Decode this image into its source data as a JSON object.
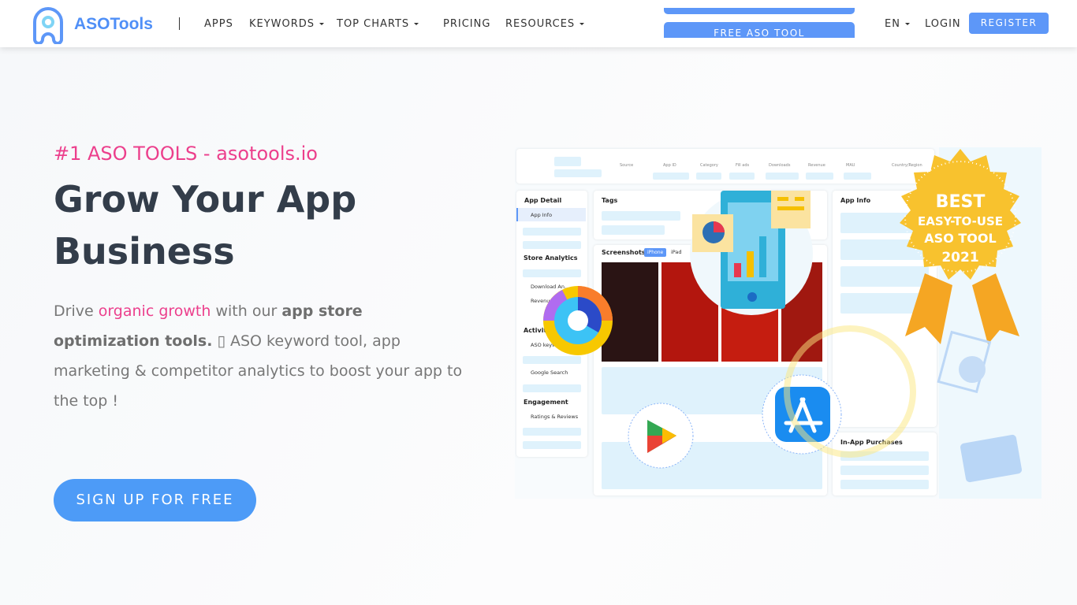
{
  "nav": {
    "logo_text": "ASOTools",
    "items": [
      {
        "label": "APPS",
        "dropdown": false
      },
      {
        "label": "KEYWORDS",
        "dropdown": true
      },
      {
        "label": "TOP CHARTS",
        "dropdown": true
      },
      {
        "label": "PRICING",
        "dropdown": false
      },
      {
        "label": "RESOURCES",
        "dropdown": true
      }
    ],
    "free_tool": "FREE ASO TOOL",
    "language": "EN",
    "login": "LOGIN",
    "register": "REGISTER"
  },
  "hero": {
    "tagline": "#1 ASO TOOLS - asotools.io",
    "title": "Grow Your App Business",
    "desc": {
      "p1": "Drive ",
      "link": "organic growth",
      "p2": " with our ",
      "bold": "app store optimization tools.",
      "p3": " ▯ ASO keyword tool, app marketing & competitor analytics to boost your app to the top !"
    },
    "cta": "SIGN UP FOR FREE"
  },
  "mockup": {
    "columns": [
      "Source",
      "App ID",
      "Category",
      "Fill ads",
      "Downloads",
      "Revenue",
      "MAU",
      "Country/Region"
    ],
    "sidebar": {
      "app_detail": "App Detail",
      "app_info": "App Info",
      "store_analytics": "Store Analytics",
      "download": "Download An...",
      "revenue": "Revenue",
      "activity": "Activity",
      "aso_keywords": "ASO keywords",
      "google_search": "Google Search",
      "engagement": "Engagement",
      "ratings": "Ratings & Reviews"
    },
    "tags": "Tags",
    "screenshots": "Screenshots",
    "iphone": "iPhone",
    "ipad": "iPad",
    "app_info": "App Info",
    "in_app": "In-App Purchases",
    "badge": [
      "BEST",
      "EASY-TO-USE",
      "ASO TOOL",
      "2021"
    ]
  },
  "colors": {
    "accent": "#5d97f8",
    "pink": "#ec3f8c",
    "title": "#333d4a"
  }
}
